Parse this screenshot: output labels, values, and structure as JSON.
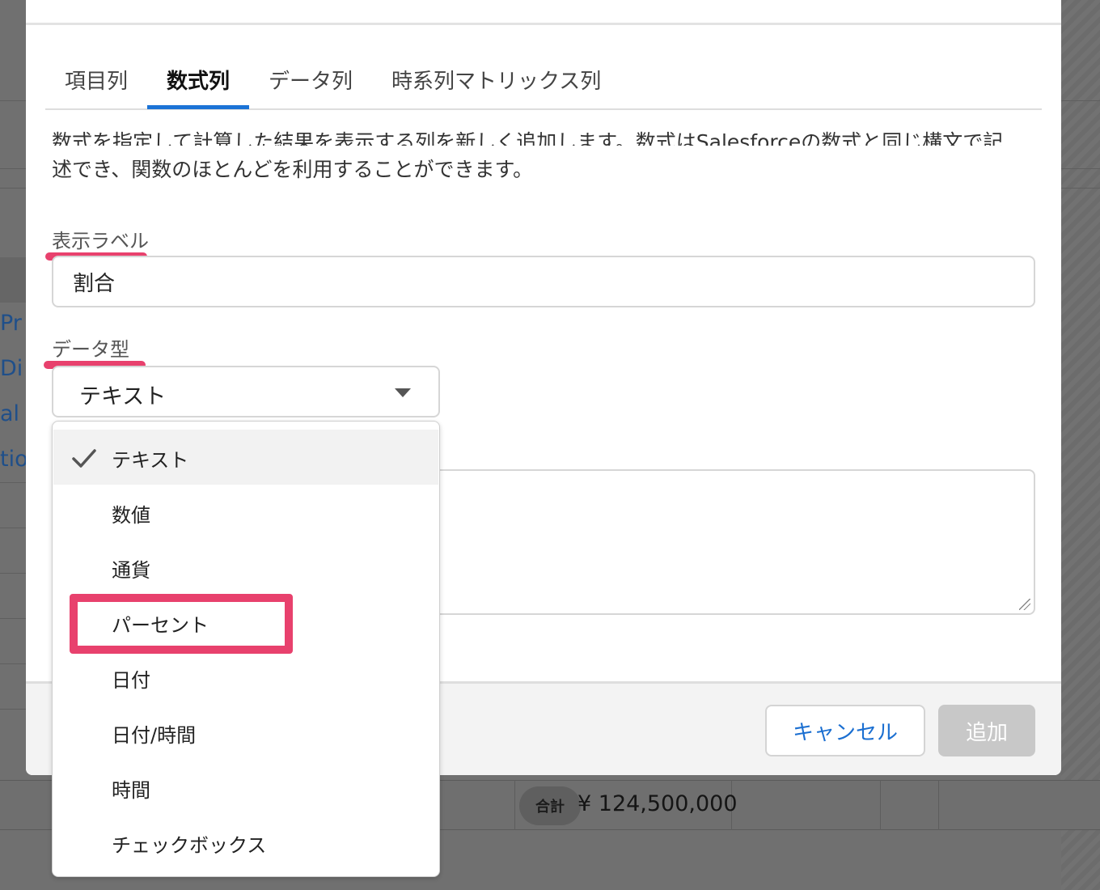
{
  "background": {
    "links": [
      "Pr",
      "Di",
      "al",
      "tio"
    ],
    "total_label": "合計",
    "total_amount": "¥ 124,500,000"
  },
  "modal": {
    "tabs": [
      {
        "label": "項目列",
        "active": false
      },
      {
        "label": "数式列",
        "active": true
      },
      {
        "label": "データ列",
        "active": false
      },
      {
        "label": "時系列マトリックス列",
        "active": false
      }
    ],
    "description_line1": "数式を指定して計算した結果を表示する列を新しく追加します。数式はSalesforceの数式と同じ構文で記",
    "description_line2": "述でき、関数のほとんどを利用することができます。",
    "display_label": {
      "label": "表示ラベル",
      "value": "割合"
    },
    "data_type": {
      "label": "データ型",
      "selected": "テキスト",
      "options": [
        "テキスト",
        "数値",
        "通貨",
        "パーセント",
        "日付",
        "日付/時間",
        "時間",
        "チェックボックス"
      ]
    },
    "footer": {
      "cancel_label": "キャンセル",
      "add_label": "追加"
    }
  },
  "colors": {
    "accent": "#1b73d6",
    "highlight": "#e8416d",
    "link": "#1b6fd1",
    "disabled_button": "#c8c8c8"
  },
  "icons": {
    "selected_check": "check-icon",
    "select_caret": "caret-down-icon",
    "textarea_resize": "resize-grip-icon"
  }
}
